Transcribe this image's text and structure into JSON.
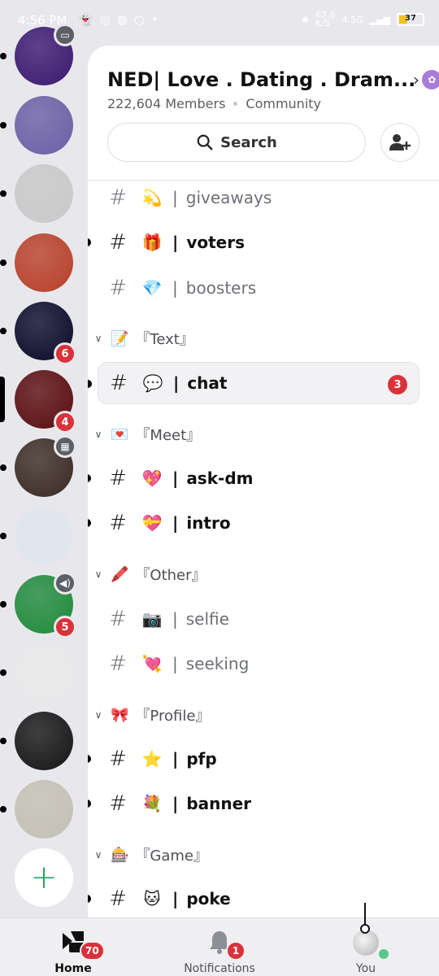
{
  "status_bar": {
    "time": "4:56 PM",
    "net_speed": "62.6",
    "net_unit": "K/S",
    "network": "4.5G",
    "battery": "37",
    "battery_level_pct": 37
  },
  "servers": [
    {
      "name": "server-p-logo",
      "color": "#3a1870",
      "pill": "dot",
      "grey_badge": "monitor-icon"
    },
    {
      "name": "server-anime-girl",
      "color": "#6b5fa5",
      "pill": "dot"
    },
    {
      "name": "server-cat",
      "color": "#c9c9c9",
      "pill": "dot"
    },
    {
      "name": "server-tea",
      "color": "#b8402a",
      "pill": "dot"
    },
    {
      "name": "server-dark-blue",
      "color": "#0a0a2a",
      "pill": "dot",
      "badge": "6"
    },
    {
      "name": "server-ned",
      "color": "#5a0c10",
      "pill": "selected",
      "badge": "4"
    },
    {
      "name": "server-dark-brown",
      "color": "#3a2a22",
      "pill": "dot",
      "grey_badge": "calendar-icon"
    },
    {
      "name": "server-sketch",
      "color": "#dfe6ef",
      "pill": "dot"
    },
    {
      "name": "server-fz",
      "color": "#1f8a3a",
      "pill": "dot",
      "badge": "5",
      "grey_badge": "speaker-icon"
    },
    {
      "name": "server-white-figure",
      "color": "#e9e9e9",
      "pill": "dot"
    },
    {
      "name": "server-dark",
      "color": "#151515",
      "pill": "dot"
    },
    {
      "name": "server-jester-ferret",
      "color": "#c4c0b4",
      "pill": "dot"
    }
  ],
  "server": {
    "title": "NED| Love . Dating . Dram...",
    "members": "222,604 Members",
    "type": "Community",
    "search_label": "Search"
  },
  "channels": [
    {
      "kind": "channel",
      "emoji": "💫",
      "name": "giveaways",
      "style": "muted"
    },
    {
      "kind": "channel",
      "emoji": "🎁",
      "name": "voters",
      "style": "bold",
      "unread": true
    },
    {
      "kind": "channel",
      "emoji": "💎",
      "name": "boosters",
      "style": "muted"
    },
    {
      "kind": "category",
      "emoji": "📝",
      "name": "『Text』"
    },
    {
      "kind": "channel",
      "emoji": "💬",
      "name": "chat",
      "style": "selected",
      "unread": true,
      "count": "3"
    },
    {
      "kind": "category",
      "emoji": "💌",
      "name": "『Meet』"
    },
    {
      "kind": "channel",
      "emoji": "💖",
      "name": "ask-dm",
      "style": "bold",
      "unread": true
    },
    {
      "kind": "channel",
      "emoji": "💝",
      "name": "intro",
      "style": "bold",
      "unread": true
    },
    {
      "kind": "category",
      "emoji": "🖍️",
      "name": "『Other』"
    },
    {
      "kind": "channel",
      "emoji": "📷",
      "name": "selfie",
      "style": "muted"
    },
    {
      "kind": "channel",
      "emoji": "💘",
      "name": "seeking",
      "style": "muted"
    },
    {
      "kind": "category",
      "emoji": "🎀",
      "name": "『Profile』"
    },
    {
      "kind": "channel",
      "emoji": "⭐",
      "name": "pfp",
      "style": "bold",
      "unread": true
    },
    {
      "kind": "channel",
      "emoji": "💐",
      "name": "banner",
      "style": "bold",
      "unread": true
    },
    {
      "kind": "category",
      "emoji": "🎰",
      "name": "『Game』"
    },
    {
      "kind": "channel",
      "emoji": "🐱",
      "name": "poke",
      "style": "bold",
      "unread": true
    }
  ],
  "nav": {
    "home_label": "Home",
    "home_badge": "70",
    "notifications_label": "Notifications",
    "notifications_badge": "1",
    "you_label": "You"
  },
  "colors": {
    "accent_red": "#d9323a",
    "online_green": "#5ac88a",
    "add_green": "#23a55a"
  }
}
